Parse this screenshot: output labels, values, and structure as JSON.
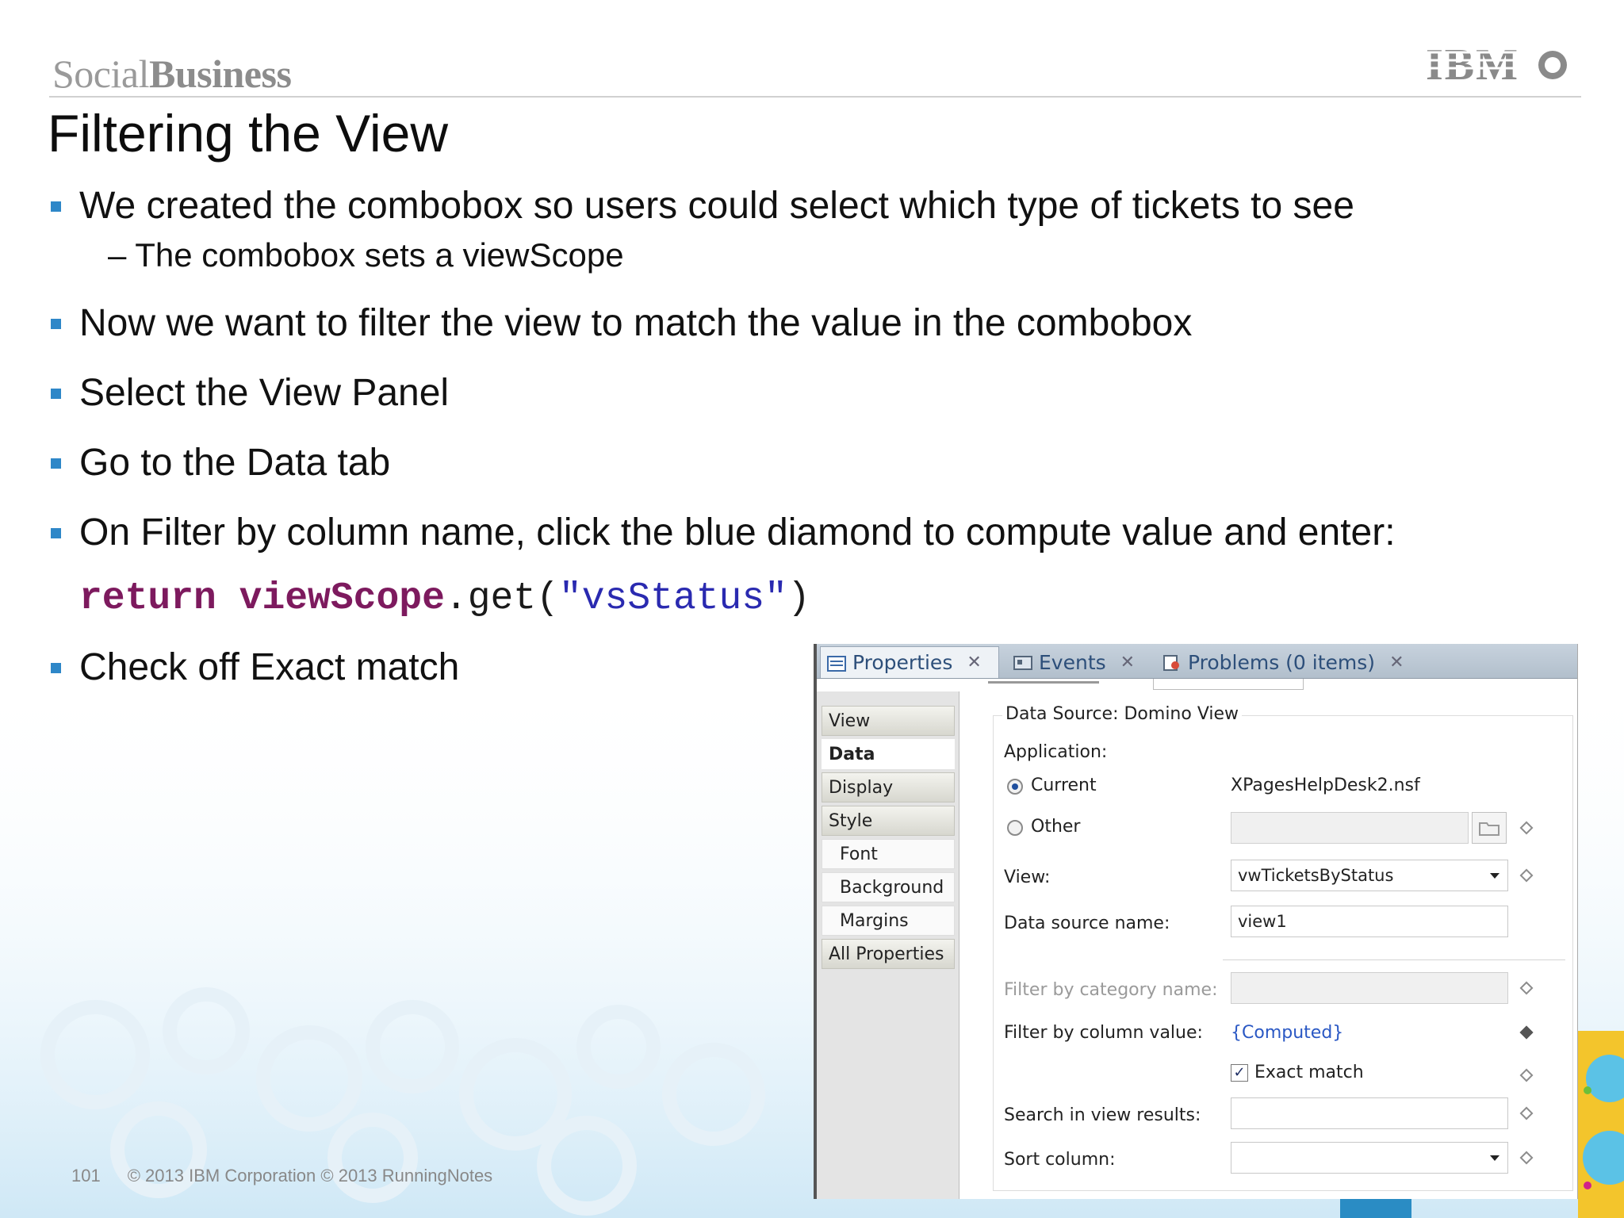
{
  "header": {
    "brand_light": "Social",
    "brand_bold": "Business",
    "logo": "IBM"
  },
  "slide": {
    "title": "Filtering the View",
    "bullets": [
      "We created the combobox so users could select which type of tickets to see",
      "Now we want to filter the view to match the value in the combobox",
      "Select the View Panel",
      "Go to the Data tab",
      "On Filter by column name, click the blue diamond to compute value and enter:",
      "Check off Exact match"
    ],
    "sub_bullet": "– The combobox sets a viewScope",
    "code": {
      "kw1": "return",
      "kw2": "viewScope",
      "method": ".get(",
      "str": "\"vsStatus\"",
      "close": ")"
    }
  },
  "footer": {
    "page": "101",
    "copyright": "© 2013 IBM Corporation  © 2013 RunningNotes"
  },
  "panel": {
    "tabs": {
      "properties": "Properties",
      "events": "Events",
      "problems": "Problems (0 items)"
    },
    "sidebar": [
      "View",
      "Data",
      "Display",
      "Style",
      "Font",
      "Background",
      "Margins",
      "All Properties"
    ],
    "group_title": "Data Source: Domino View",
    "application_label": "Application:",
    "current_label": "Current",
    "current_value": "XPagesHelpDesk2.nsf",
    "other_label": "Other",
    "view_label": "View:",
    "view_value": "vwTicketsByStatus",
    "data_source_name_label": "Data source name:",
    "data_source_name_value": "view1",
    "filter_category_label": "Filter by category name:",
    "filter_column_label": "Filter by column value:",
    "filter_column_value": "{Computed}",
    "exact_match_label": "Exact match",
    "exact_match_checked": true,
    "search_label": "Search in view results:",
    "sort_label": "Sort column:",
    "selected_radio": "Current",
    "selected_tab": "Data"
  },
  "colors": {
    "bullet": "#2e87c8",
    "code_keyword": "#7d1a5e",
    "code_string": "#2a2ab0",
    "computed_value": "#2a58c4"
  }
}
